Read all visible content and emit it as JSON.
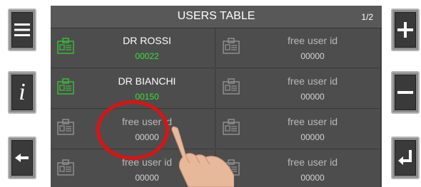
{
  "table": {
    "title": "USERS TABLE",
    "page": "1/2",
    "cells": [
      {
        "name": "DR ROSSI",
        "code": "00022",
        "status": "assigned"
      },
      {
        "name": "free user id",
        "code": "00000",
        "status": "free"
      },
      {
        "name": "DR BIANCHI",
        "code": "00150",
        "status": "assigned"
      },
      {
        "name": "free user id",
        "code": "00000",
        "status": "free"
      },
      {
        "name": "free user id",
        "code": "00000",
        "status": "free"
      },
      {
        "name": "free user id",
        "code": "00000",
        "status": "free"
      },
      {
        "name": "free user id",
        "code": "00000",
        "status": "free"
      },
      {
        "name": "free user id",
        "code": "00000",
        "status": "free"
      }
    ]
  },
  "left_buttons": [
    {
      "icon": "menu-icon"
    },
    {
      "icon": "info-icon",
      "glyph": "i"
    },
    {
      "icon": "back-arrow-icon"
    }
  ],
  "right_buttons": [
    {
      "icon": "plus-icon"
    },
    {
      "icon": "minus-icon"
    },
    {
      "icon": "enter-icon"
    }
  ],
  "colors": {
    "assigned_code": "#38e038",
    "assigned_badge": "#3bb23b",
    "free_badge": "#8a8a8a",
    "highlight": "#d81414"
  }
}
